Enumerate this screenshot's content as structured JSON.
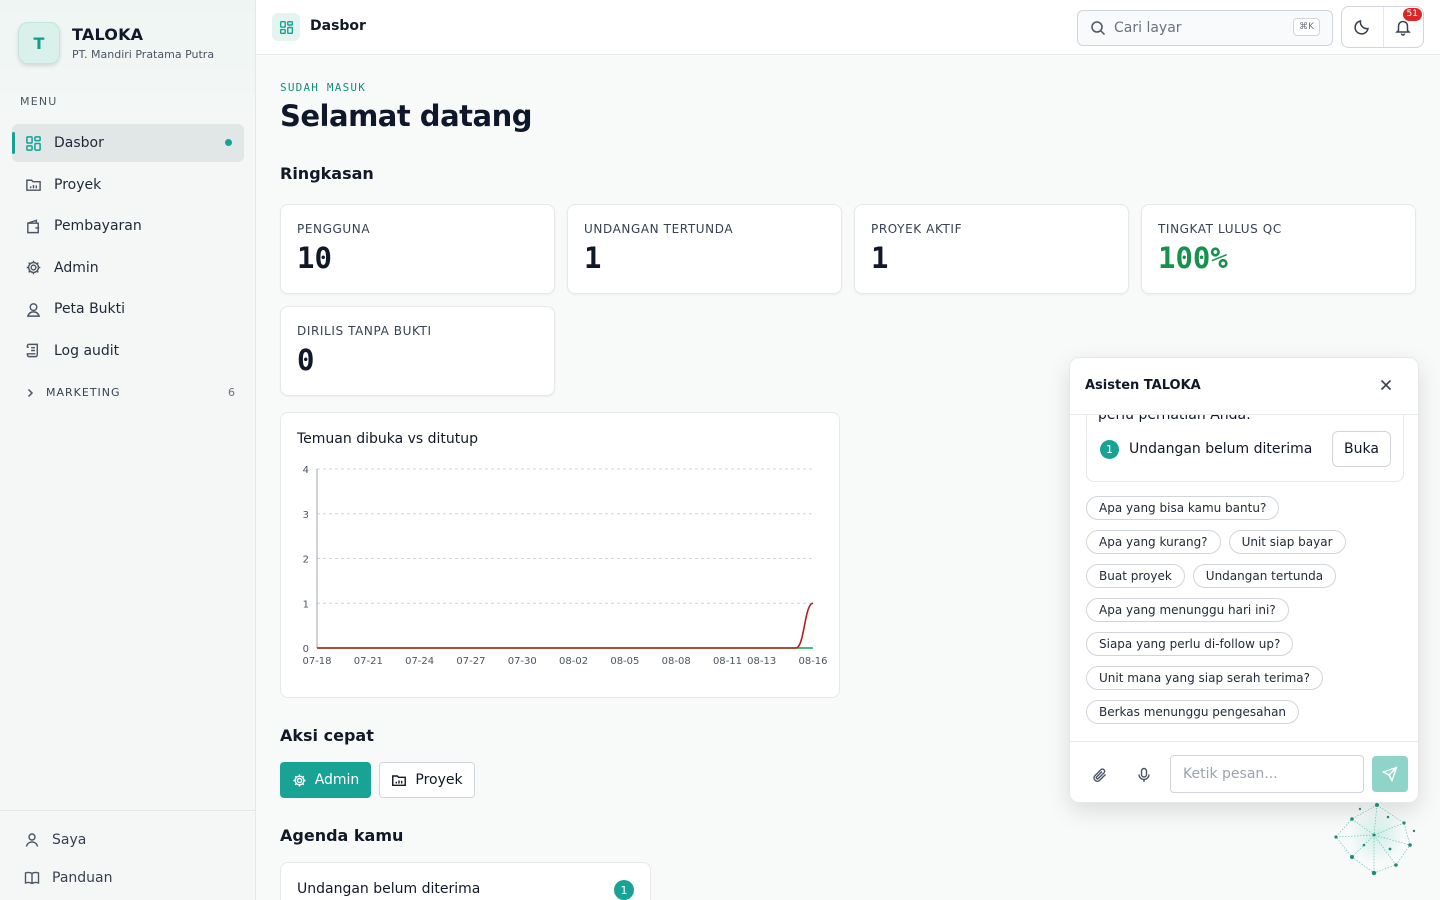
{
  "brand": {
    "initial": "T",
    "name": "TALOKA",
    "company": "PT. Mandiri Pratama Putra"
  },
  "sidebar": {
    "menu_label": "MENU",
    "items": [
      {
        "label": "Dasbor",
        "icon": "grid-icon",
        "active": true
      },
      {
        "label": "Proyek",
        "icon": "folder-chart-icon"
      },
      {
        "label": "Pembayaran",
        "icon": "wallet-icon"
      },
      {
        "label": "Admin",
        "icon": "gear-icon"
      },
      {
        "label": "Peta Bukti",
        "icon": "map-pin-icon"
      },
      {
        "label": "Log audit",
        "icon": "scroll-icon"
      }
    ],
    "section": {
      "label": "MARKETING",
      "count": "6"
    },
    "bottom": [
      {
        "label": "Saya",
        "icon": "user-icon"
      },
      {
        "label": "Panduan",
        "icon": "book-icon"
      }
    ]
  },
  "topbar": {
    "breadcrumb": "Dasbor",
    "search_placeholder": "Cari layar",
    "search_shortcut": "⌘K",
    "notification_count": "51"
  },
  "main": {
    "eyebrow": "SUDAH MASUK",
    "title": "Selamat datang",
    "summary_heading": "Ringkasan",
    "stats": [
      {
        "label": "PENGGUNA",
        "value": "10"
      },
      {
        "label": "UNDANGAN TERTUNDA",
        "value": "1"
      },
      {
        "label": "PROYEK AKTIF",
        "value": "1"
      },
      {
        "label": "TINGKAT LULUS QC",
        "value": "100%"
      },
      {
        "label": "DIRILIS TANPA BUKTI",
        "value": "0"
      }
    ],
    "quick_actions_heading": "Aksi cepat",
    "quick_actions": [
      {
        "label": "Admin"
      },
      {
        "label": "Proyek"
      }
    ],
    "agenda_heading": "Agenda kamu",
    "agenda": [
      {
        "label": "Undangan belum diterima",
        "count": "1"
      }
    ]
  },
  "chart_data": {
    "type": "line",
    "title": "Temuan dibuka vs ditutup",
    "x": [
      "07-18",
      "07-19",
      "07-20",
      "07-21",
      "07-22",
      "07-23",
      "07-24",
      "07-25",
      "07-26",
      "07-27",
      "07-28",
      "07-29",
      "07-30",
      "07-31",
      "08-01",
      "08-02",
      "08-03",
      "08-04",
      "08-05",
      "08-06",
      "08-07",
      "08-08",
      "08-09",
      "08-10",
      "08-11",
      "08-12",
      "08-13",
      "08-14",
      "08-15",
      "08-16"
    ],
    "tick_labels": [
      "07-18",
      "07-21",
      "07-24",
      "07-27",
      "07-30",
      "08-02",
      "08-05",
      "08-08",
      "08-11",
      "08-13",
      "08-16"
    ],
    "ylim": [
      0,
      4
    ],
    "yticks": [
      0,
      1,
      2,
      3,
      4
    ],
    "grid": true,
    "series": [
      {
        "color": "#b91c1c",
        "values": [
          0,
          0,
          0,
          0,
          0,
          0,
          0,
          0,
          0,
          0,
          0,
          0,
          0,
          0,
          0,
          0,
          0,
          0,
          0,
          0,
          0,
          0,
          0,
          0,
          0,
          0,
          0,
          0,
          0,
          1
        ]
      },
      {
        "color": "#16a34a",
        "values": [
          0,
          0,
          0,
          0,
          0,
          0,
          0,
          0,
          0,
          0,
          0,
          0,
          0,
          0,
          0,
          0,
          0,
          0,
          0,
          0,
          0,
          0,
          0,
          0,
          0,
          0,
          0,
          0,
          0,
          0
        ]
      }
    ]
  },
  "assistant": {
    "title": "Asisten TALOKA",
    "cut_text": "perlu perhatian Anda:",
    "item": {
      "num": "1",
      "label": "Undangan belum diterima",
      "action": "Buka"
    },
    "chips": [
      [
        "Apa yang bisa kamu bantu?"
      ],
      [
        "Apa yang kurang?",
        "Unit siap bayar"
      ],
      [
        "Buat proyek",
        "Undangan tertunda"
      ],
      [
        "Apa yang menunggu hari ini?"
      ],
      [
        "Siapa yang perlu di-follow up?"
      ],
      [
        "Unit mana yang siap serah terima?"
      ],
      [
        "Berkas menunggu pengesahan"
      ]
    ],
    "input_placeholder": "Ketik pesan..."
  },
  "colors": {
    "accent": "#19a394",
    "success": "#17914b",
    "danger": "#dc2626"
  }
}
